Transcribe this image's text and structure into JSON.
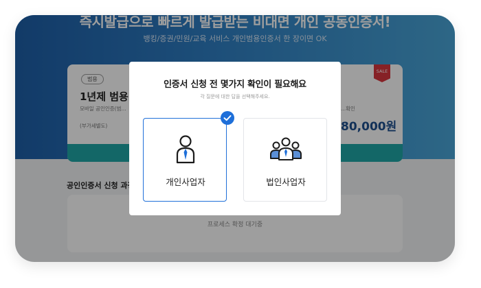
{
  "background": {
    "hero_title": "즉시발급으로 빠르게 발급받는 비대면 개인 공동인증서!",
    "hero_subtitle": "뱅킹/증권/민원/교육 서비스 개인범용인증서 한 장이면 OK",
    "product_card": {
      "tag": "범용",
      "name": "1년제 범용",
      "description": "모바일 공인인증(범...",
      "vat_note": "(부가세별도)",
      "confirm_note": "...확인",
      "price": "80,000원",
      "sale_badge": "SALE"
    },
    "section_title": "공인인증서 신청 과정",
    "process_placeholder": "프로세스 확정 대기중"
  },
  "modal": {
    "title": "인증서 신청 전 몇가지 확인이 필요해요",
    "subtitle": "각 질문에 대한 답을 선택해주세요.",
    "options": [
      {
        "label": "개인사업자",
        "icon": "person-icon",
        "selected": true
      },
      {
        "label": "법인사업자",
        "icon": "group-icon",
        "selected": false
      }
    ]
  },
  "colors": {
    "accent": "#1e6fd9",
    "hero": "#2f7fc4",
    "card_bar": "#1fa7a7",
    "price": "#1d4f8f",
    "sale": "#d9363e"
  }
}
